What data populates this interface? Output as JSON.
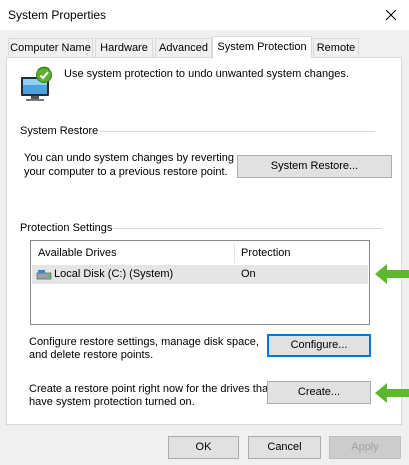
{
  "window": {
    "title": "System Properties",
    "close_icon": "close-icon"
  },
  "tabs": [
    {
      "label": "Computer Name",
      "active": false
    },
    {
      "label": "Hardware",
      "active": false
    },
    {
      "label": "Advanced",
      "active": false
    },
    {
      "label": "System Protection",
      "active": true
    },
    {
      "label": "Remote",
      "active": false
    }
  ],
  "intro": {
    "icon": "system-protection-icon",
    "text": "Use system protection to undo unwanted system changes."
  },
  "system_restore": {
    "heading": "System Restore",
    "description_line1": "You can undo system changes by reverting",
    "description_line2": "your computer to a previous restore point.",
    "button_label": "System Restore..."
  },
  "protection_settings": {
    "heading": "Protection Settings",
    "columns": [
      "Available Drives",
      "Protection"
    ],
    "rows": [
      {
        "drive": "Local Disk (C:) (System)",
        "protection": "On",
        "icon": "drive-icon"
      }
    ]
  },
  "configure": {
    "text_line1": "Configure restore settings, manage disk space,",
    "text_line2": "and delete restore points.",
    "button_label": "Configure..."
  },
  "create": {
    "text_line1": "Create a restore point right now for the drives that",
    "text_line2": "have system protection turned on.",
    "button_label": "Create..."
  },
  "footer": {
    "ok_label": "OK",
    "cancel_label": "Cancel",
    "apply_label": "Apply"
  },
  "annotations": {
    "arrow_color": "#5cb82e",
    "arrow_icon": "green-arrow-icon"
  },
  "colors": {
    "accent": "#0078d7",
    "selected_row": "#e5e5e5"
  }
}
